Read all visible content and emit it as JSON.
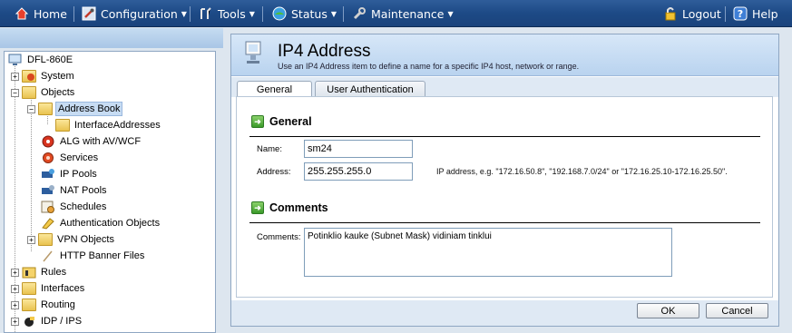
{
  "menubar": {
    "items": [
      {
        "label": "Home",
        "icon": "home-icon"
      },
      {
        "label": "Configuration",
        "icon": "wrench-icon"
      },
      {
        "label": "Tools",
        "icon": "tools-icon"
      },
      {
        "label": "Status",
        "icon": "status-globe-icon"
      },
      {
        "label": "Maintenance",
        "icon": "maintenance-icon"
      },
      {
        "label": "Logout",
        "icon": "lock-icon"
      },
      {
        "label": "Help",
        "icon": "help-icon"
      }
    ],
    "colors": {
      "bar": "#1d4a86",
      "text": "#ffffff"
    }
  },
  "tree": {
    "items": [
      {
        "label": "DFL-860E",
        "icon": "device-icon"
      },
      {
        "label": "System",
        "icon": "system-folder-icon",
        "toggle": "+"
      },
      {
        "label": "Objects",
        "icon": "folder-icon",
        "toggle": "-"
      },
      {
        "label": "Address Book",
        "icon": "address-book-folder-icon",
        "toggle": "-",
        "selected": true
      },
      {
        "label": "InterfaceAddresses",
        "icon": "folder-icon"
      },
      {
        "label": "ALG with AV/WCF",
        "icon": "alg-icon"
      },
      {
        "label": "Services",
        "icon": "services-icon"
      },
      {
        "label": "IP Pools",
        "icon": "ip-pools-icon"
      },
      {
        "label": "NAT Pools",
        "icon": "nat-pools-icon"
      },
      {
        "label": "Schedules",
        "icon": "schedules-icon"
      },
      {
        "label": "Authentication Objects",
        "icon": "authentication-icon"
      },
      {
        "label": "VPN Objects",
        "icon": "vpn-folder-icon",
        "toggle": "+"
      },
      {
        "label": "HTTP Banner Files",
        "icon": "banner-file-icon"
      },
      {
        "label": "Rules",
        "icon": "rules-folder-icon",
        "toggle": "+"
      },
      {
        "label": "Interfaces",
        "icon": "interfaces-folder-icon",
        "toggle": "+"
      },
      {
        "label": "Routing",
        "icon": "routing-folder-icon",
        "toggle": "+"
      },
      {
        "label": "IDP / IPS",
        "icon": "idp-ips-icon",
        "toggle": "+"
      }
    ]
  },
  "page": {
    "title": "IP4 Address",
    "subtitle": "Use an IP4 Address item to define a name for a specific IP4 host, network or range.",
    "tabs": [
      {
        "label": "General",
        "active": true
      },
      {
        "label": "User Authentication",
        "active": false
      }
    ]
  },
  "general": {
    "heading": "General",
    "name_label": "Name:",
    "name_value": "sm24",
    "address_label": "Address:",
    "address_value": "255.255.255.0",
    "address_hint": "IP address, e.g. \"172.16.50.8\", \"192.168.7.0/24\" or \"172.16.25.10-172.16.25.50\"."
  },
  "comments": {
    "heading": "Comments",
    "label": "Comments:",
    "value": "Potinklio kauke (Subnet Mask) vidiniam tinklui"
  },
  "buttons": {
    "ok": "OK",
    "cancel": "Cancel"
  }
}
